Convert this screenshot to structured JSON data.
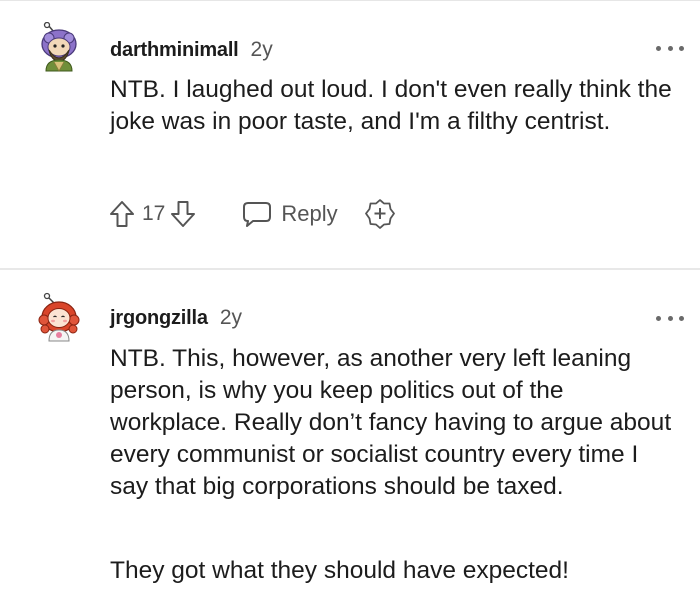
{
  "comments": [
    {
      "username": "darthminimall",
      "age": "2y",
      "body": "NTB. I laughed out loud. I don't even really think the joke was in poor taste, and I'm a filthy centrist.",
      "votes": "17",
      "reply_label": "Reply",
      "avatar_icon": "snoo-avatar-purple-icon",
      "more_icon": "more-options-icon"
    },
    {
      "username": "jrgongzilla",
      "age": "2y",
      "paragraphs": [
        "NTB. This, however, as another very left leaning person, is why you keep politics out of the workplace. Really don’t fancy having to argue about every communist or socialist country every time I say that big corporations should be taxed.",
        "They got what they should have expected!"
      ],
      "avatar_icon": "snoo-avatar-redhair-icon",
      "more_icon": "more-options-icon"
    }
  ],
  "colors": {
    "text": "#1c1c1c",
    "meta": "#555555",
    "divider": "#e8e8e8"
  }
}
